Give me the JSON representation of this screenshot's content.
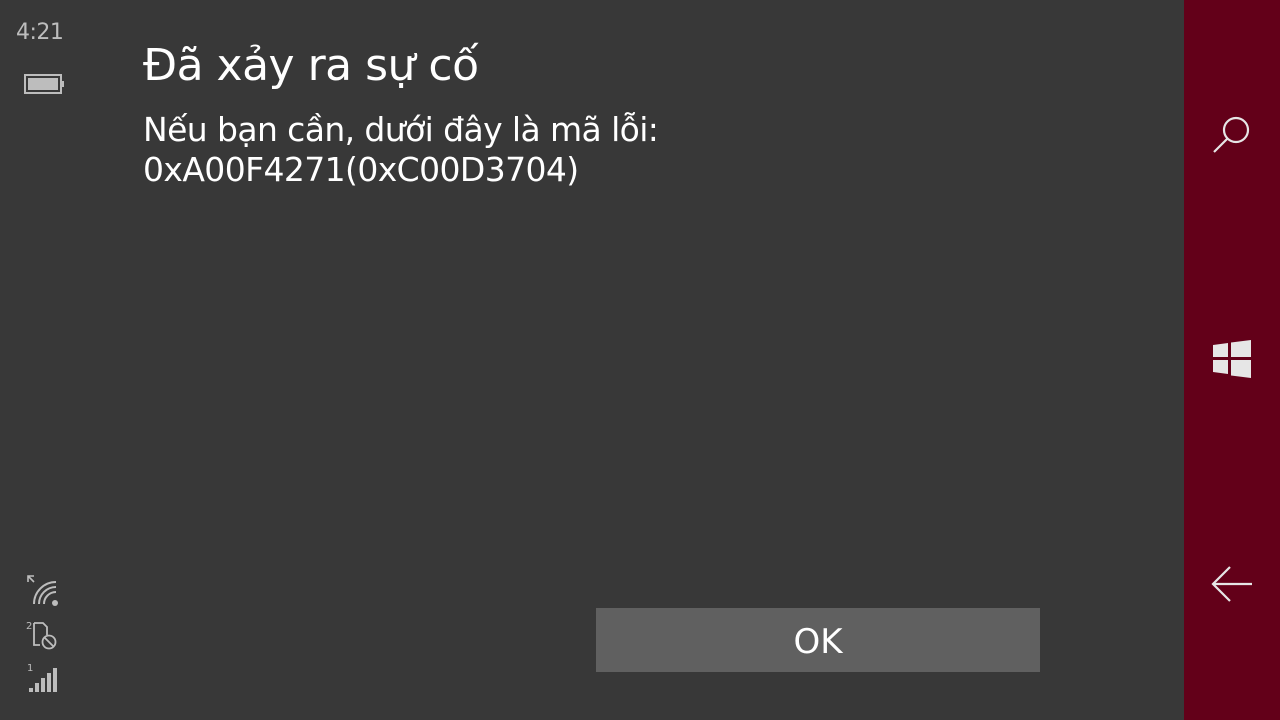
{
  "status_bar": {
    "time": "4:21",
    "icons": [
      "battery-icon",
      "wifi-icon",
      "sim2-icon",
      "signal-icon"
    ],
    "sim2_label": "2",
    "sim1_label": "1"
  },
  "dialog": {
    "title": "Đã xảy ra sự cố",
    "message_line1": "Nếu bạn cần, dưới đây là mã lỗi:",
    "message_line2": "0xA00F4271(0xC00D3704)",
    "ok_label": "OK"
  },
  "nav_bar": {
    "buttons": [
      "search-icon",
      "windows-icon",
      "back-arrow-icon"
    ]
  },
  "colors": {
    "background": "#383838",
    "nav_bar": "#630019",
    "button": "#606060",
    "text": "#ffffff"
  }
}
